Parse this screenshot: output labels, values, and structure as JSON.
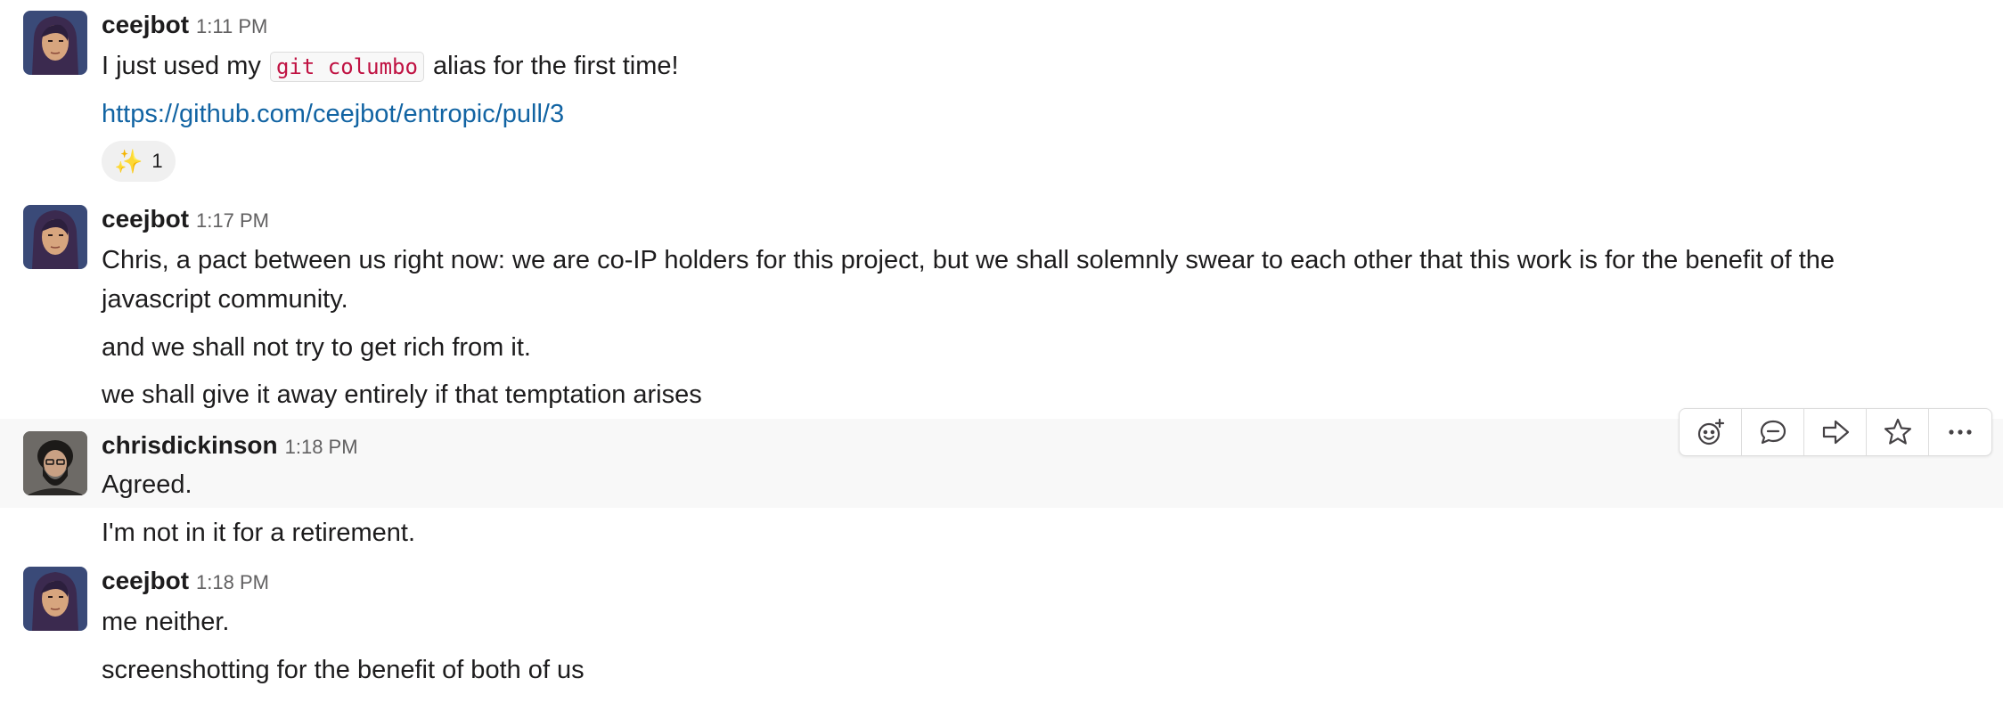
{
  "messages": [
    {
      "author": "ceejbot",
      "time": "1:11 PM",
      "line1_before": "I just used my ",
      "line1_code": "git columbo",
      "line1_after": " alias for the first time!",
      "link": "https://github.com/ceejbot/entropic/pull/3",
      "reaction": {
        "emoji": "✨",
        "count": "1"
      }
    },
    {
      "author": "ceejbot",
      "time": "1:17 PM",
      "lines": [
        "Chris, a pact between us right now: we are co-IP holders for this project, but we shall solemnly swear to each other that this work is for the benefit of the javascript community.",
        "and we shall not try to get rich from it.",
        "we  shall give it away entirely if that temptation arises"
      ]
    },
    {
      "author": "chrisdickinson",
      "time": "1:18 PM",
      "lines": [
        "Agreed.",
        "I'm not in it for a retirement."
      ]
    },
    {
      "author": "ceejbot",
      "time": "1:18 PM",
      "lines": [
        "me neither.",
        "screenshotting for the benefit of both of us"
      ]
    }
  ],
  "toolbar": {
    "icons": [
      "add-reaction-icon",
      "reply-in-thread-icon",
      "share-message-icon",
      "save-star-icon",
      "more-actions-icon"
    ]
  },
  "colors": {
    "link": "#1264a3",
    "code_text": "#c01343",
    "hover_bg": "#f8f8f8",
    "timestamp": "#616061"
  }
}
